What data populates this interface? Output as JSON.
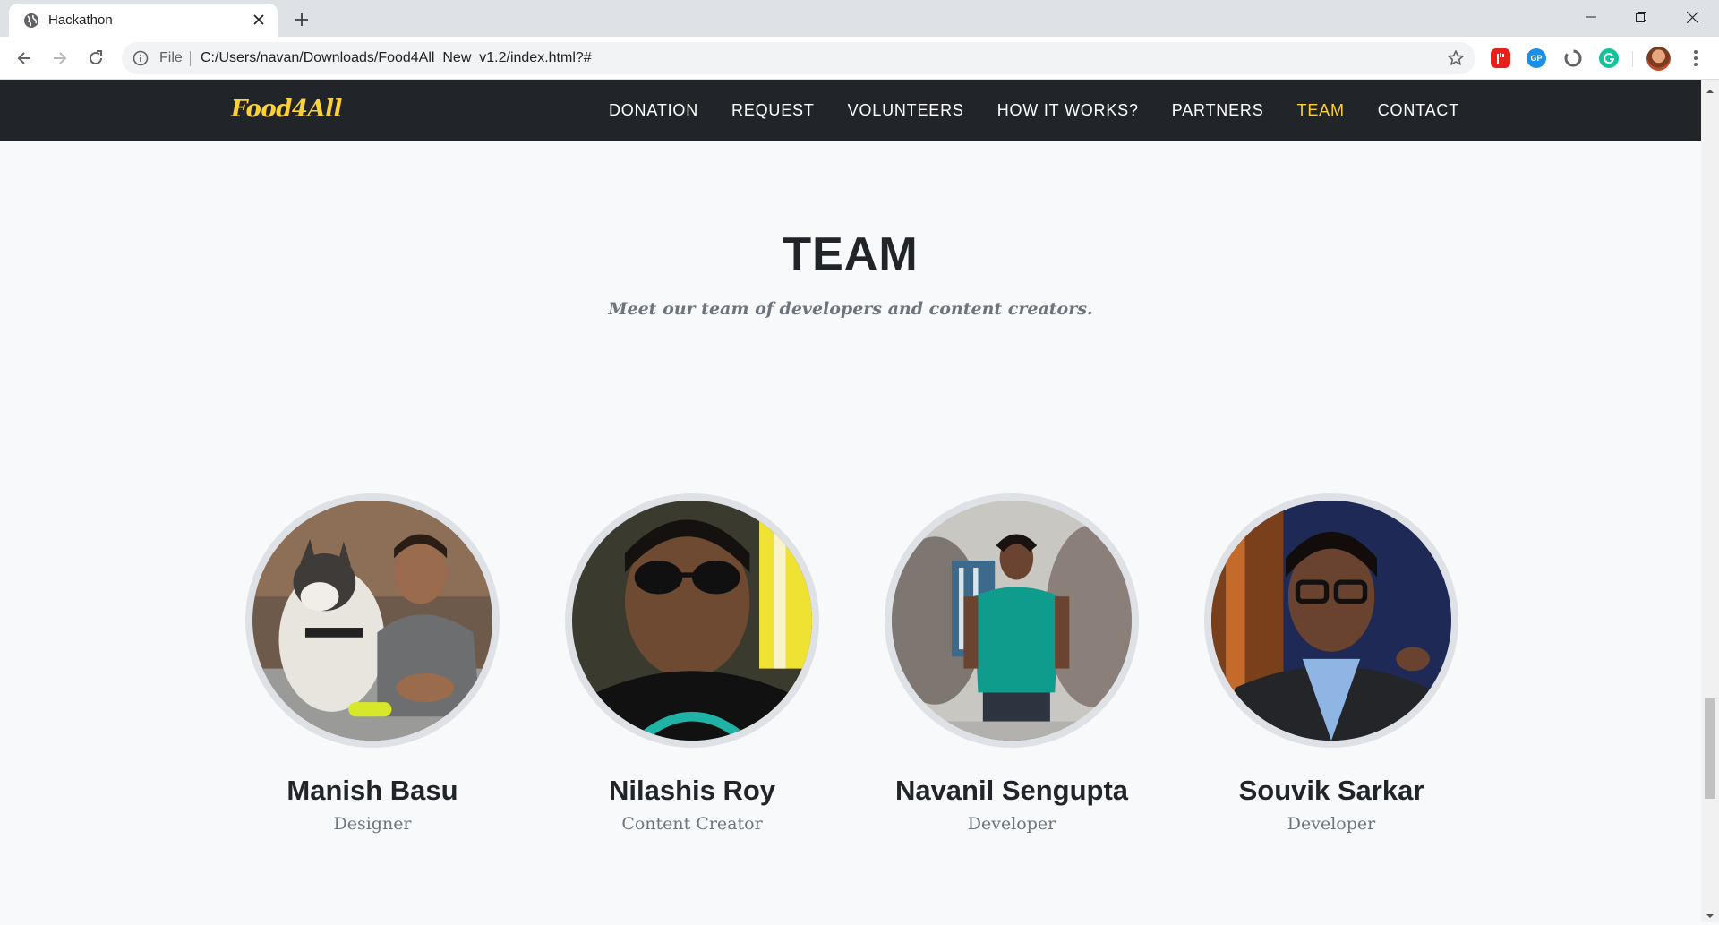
{
  "browser": {
    "tab_title": "Hackathon",
    "omnibox_scheme_label": "File",
    "url": "C:/Users/navan/Downloads/Food4All_New_v1.2/index.html?#"
  },
  "site": {
    "brand": "Food4All",
    "nav": [
      {
        "label": "DONATION",
        "active": false
      },
      {
        "label": "REQUEST",
        "active": false
      },
      {
        "label": "VOLUNTEERS",
        "active": false
      },
      {
        "label": "HOW IT WORKS?",
        "active": false
      },
      {
        "label": "PARTNERS",
        "active": false
      },
      {
        "label": "TEAM",
        "active": true
      },
      {
        "label": "CONTACT",
        "active": false
      }
    ],
    "accent_color": "#fed136",
    "nav_background": "#212529"
  },
  "team": {
    "heading": "TEAM",
    "subheading": "Meet our team of developers and content creators.",
    "members": [
      {
        "name": "Manish Basu",
        "role": "Designer",
        "photo": "person-with-husky-dog"
      },
      {
        "name": "Nilashis Roy",
        "role": "Content Creator",
        "photo": "person-with-sunglasses"
      },
      {
        "name": "Navanil Sengupta",
        "role": "Developer",
        "photo": "person-in-green-polo"
      },
      {
        "name": "Souvik Sarkar",
        "role": "Developer",
        "photo": "person-with-glasses-blazer"
      }
    ]
  }
}
